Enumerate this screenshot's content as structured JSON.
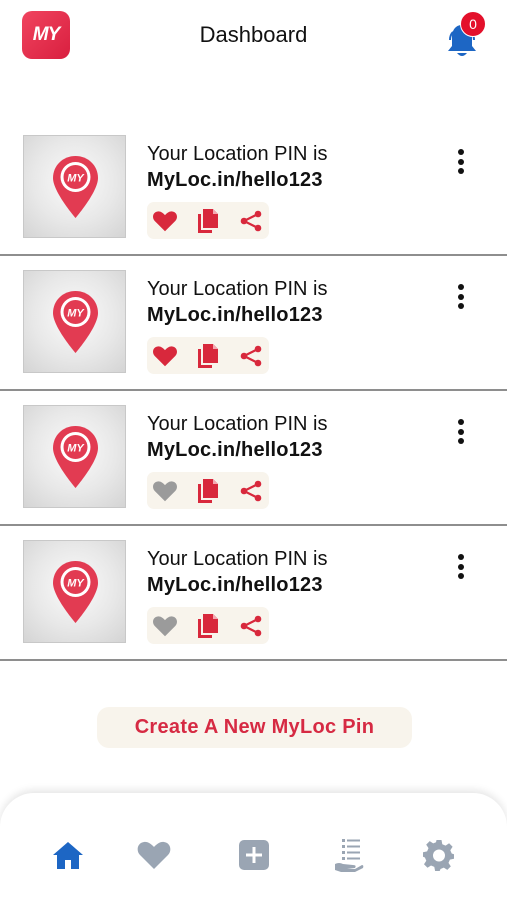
{
  "header": {
    "logo_text": "MY",
    "title": "Dashboard",
    "notification_count": "0"
  },
  "colors": {
    "brand_red": "#e23b52",
    "icon_red": "#d8283c",
    "nav_active": "#1d66c4",
    "nav_inactive": "#9aa5b3",
    "heart_inactive": "#9b9b9b",
    "action_bg": "#f8f4ec"
  },
  "pins": [
    {
      "line1": "Your Location PIN is",
      "link": "MyLoc.in/hello123",
      "favorited": true
    },
    {
      "line1": "Your Location PIN is",
      "link": "MyLoc.in/hello123",
      "favorited": true
    },
    {
      "line1": "Your Location PIN is",
      "link": "MyLoc.in/hello123",
      "favorited": false
    },
    {
      "line1": "Your Location PIN is",
      "link": "MyLoc.in/hello123",
      "favorited": false
    }
  ],
  "pin_badge_text": "MY",
  "create_button": {
    "label": "Create A New MyLoc Pin"
  },
  "bottom_nav": [
    {
      "icon": "home-icon",
      "active": true
    },
    {
      "icon": "heart-icon",
      "active": false
    },
    {
      "icon": "add-square-icon",
      "active": false
    },
    {
      "icon": "list-hand-icon",
      "active": false
    },
    {
      "icon": "settings-gear-icon",
      "active": false
    }
  ]
}
